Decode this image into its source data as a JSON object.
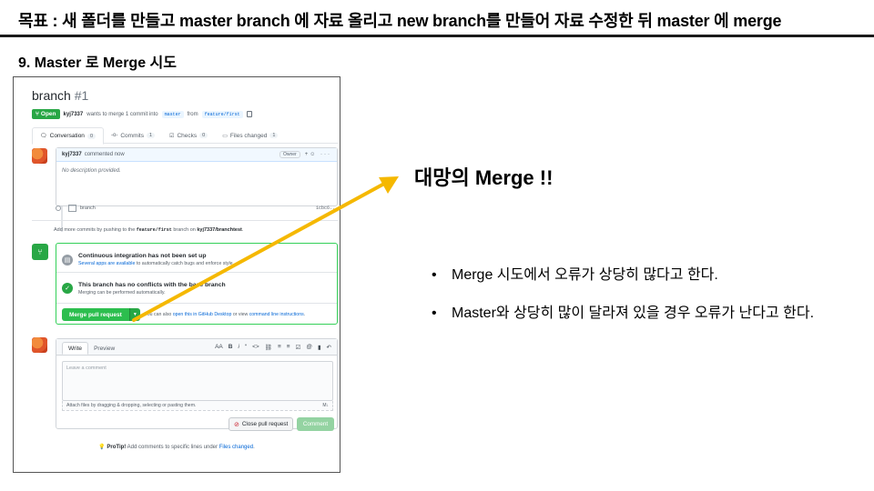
{
  "slide": {
    "title": "목표 : 새 폴더를 만들고 master branch 에 자료 올리고 new branch를 만들어 자료 수정한 뒤 master 에 merge",
    "section": "9. Master 로 Merge 시도"
  },
  "pr": {
    "title": "branch",
    "number": "#1",
    "state": "Open",
    "author": "kyj7337",
    "meta_text": "wants to merge 1 commit into",
    "base_branch": "master",
    "from_word": "from",
    "head_branch": "feature/first",
    "tabs": [
      {
        "label": "Conversation",
        "count": "0",
        "icon": "comment-icon"
      },
      {
        "label": "Commits",
        "count": "1",
        "icon": "commit-icon"
      },
      {
        "label": "Checks",
        "count": "0",
        "icon": "checklist-icon"
      },
      {
        "label": "Files changed",
        "count": "1",
        "icon": "file-diff-icon"
      }
    ],
    "comment": {
      "author": "kyj7337",
      "action": "commented now",
      "role": "Owner",
      "body": "No description provided."
    },
    "commit": {
      "message": "branch",
      "sha": "1cbc6..."
    },
    "push_hint": {
      "prefix": "Add more commits by pushing to the",
      "branch": "feature/first",
      "middle": "branch on",
      "repo": "kyj7337/branchtest",
      "suffix": "."
    },
    "merge": {
      "ci_title": "Continuous integration has not been set up",
      "ci_link": "Several apps are available",
      "ci_rest": "to automatically catch bugs and enforce style.",
      "conflict_title": "This branch has no conflicts with the base branch",
      "conflict_sub": "Merging can be performed automatically.",
      "button": "Merge pull request",
      "alt_prefix": "You can also",
      "alt_link1": "open this in GitHub Desktop",
      "alt_mid": "or view",
      "alt_link2": "command line instructions",
      "alt_suffix": "."
    },
    "editor": {
      "tab_write": "Write",
      "tab_preview": "Preview",
      "placeholder": "Leave a comment",
      "attach": "Attach files by dragging & dropping, selecting or pasting them.",
      "tools": [
        "AA",
        "B",
        "i",
        "“",
        "<>",
        "⛓",
        "≡",
        "≡",
        "☑",
        "@",
        "▮",
        "↶"
      ]
    },
    "close_button": "Close pull request",
    "comment_button": "Comment",
    "protip_bold": "ProTip!",
    "protip_text": "Add comments to specific lines under",
    "protip_link": "Files changed",
    "protip_end": "."
  },
  "annotation": {
    "callout": "대망의 Merge !!",
    "arrow_color": "#f5b800",
    "bullets": [
      "Merge 시도에서 오류가 상당히 많다고 한다.",
      "Master와 상당히 많이 달라져 있을 경우 오류가 난다고 한다."
    ]
  }
}
